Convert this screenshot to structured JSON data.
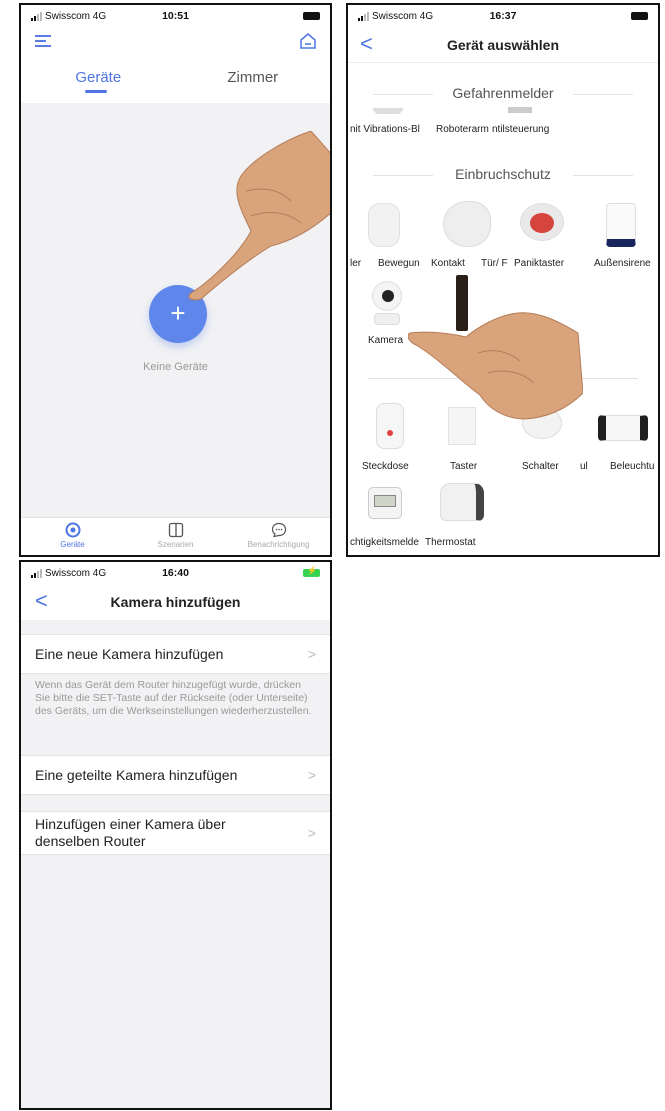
{
  "phone1": {
    "status": {
      "carrier": "Swisscom",
      "network": "4G",
      "time": "10:51"
    },
    "tabs": [
      "Geräte",
      "Zimmer"
    ],
    "empty_text": "Keine Geräte",
    "add_label": "+",
    "bottom_nav": [
      {
        "label": "Geräte",
        "icon": "devices-icon",
        "active": true
      },
      {
        "label": "Szenarien",
        "icon": "scenes-icon",
        "active": false
      },
      {
        "label": "Benachrichtigung",
        "icon": "chat-icon",
        "active": false
      }
    ],
    "accent_color": "#4f74e3"
  },
  "phone2": {
    "status": {
      "carrier": "Swisscom",
      "network": "4G",
      "time": "16:37"
    },
    "title": "Gerät auswählen",
    "back_label": "<",
    "sections": [
      {
        "title": "Gefahrenmelder",
        "items": [
          "Wasser mit Vibrations-Bl",
          "Roboterarm",
          "Ventilsteuerung"
        ]
      },
      {
        "title": "Einbruchschutz",
        "items": [
          "Melder",
          "Bewegung",
          "Kontakt",
          "Tür/ F",
          "Paniktaster",
          "Außensirene",
          "Kamera",
          "Türschloss"
        ]
      },
      {
        "title": "",
        "items": [
          "Steckdose",
          "Taster",
          "Schalter",
          "ul",
          "Beleuchtung",
          "Feuchtigkeitsmelder",
          "Thermostat"
        ]
      }
    ],
    "labels": {
      "s1_a": "nit Vibrations-Bl",
      "s1_b": "Roboterarm",
      "s1_c": "ntilsteuerung",
      "s2_a": "ler",
      "s2_b": "Bewegun",
      "s2_c": "Kontakt",
      "s2_d": "Tür/ F",
      "s2_e": "Paniktaster",
      "s2_f": "Außensirene",
      "s2_g": "Kamera",
      "s2_h": "Tü",
      "s3_a": "Steckdose",
      "s3_b": "Taster",
      "s3_c": "Schalter",
      "s3_d": "ul",
      "s3_e": "Beleuchtu",
      "s3_f": "chtigkeitsmelde",
      "s3_g": "Thermostat"
    }
  },
  "phone3": {
    "status": {
      "carrier": "Swisscom",
      "network": "4G",
      "time": "16:40"
    },
    "title": "Kamera hinzufügen",
    "back_label": "<",
    "rows": {
      "new_camera": "Eine neue Kamera hinzufügen",
      "hint": "Wenn das Gerät dem Router hinzugefügt wurde, drücken Sie bitte die SET-Taste auf der Rückseite (oder Unterseite) des Geräts, um die Werkseinstellungen wiederherzustellen.",
      "shared_camera": "Eine geteilte Kamera hinzufügen",
      "same_router_line1": "Hinzufügen einer Kamera über",
      "same_router_line2": "denselben Router",
      "chevron": ">"
    }
  }
}
